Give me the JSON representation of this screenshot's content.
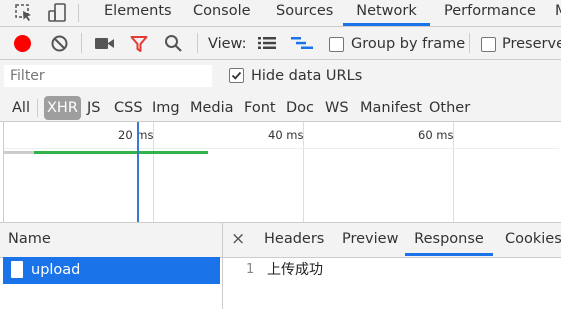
{
  "tabs": {
    "elements": "Elements",
    "console": "Console",
    "sources": "Sources",
    "network": "Network",
    "performance": "Performance",
    "memory_partial": "M"
  },
  "toolbar": {
    "view_label": "View:",
    "group_by_frame": "Group by frame",
    "preserve_log": "Preserve"
  },
  "filter": {
    "placeholder": "Filter",
    "hide_data_urls": "Hide data URLs"
  },
  "types": {
    "all": "All",
    "xhr": "XHR",
    "js": "JS",
    "css": "CSS",
    "img": "Img",
    "media": "Media",
    "font": "Font",
    "doc": "Doc",
    "ws": "WS",
    "manifest": "Manifest",
    "other": "Other"
  },
  "timeline": {
    "ticks": [
      "20 ms",
      "40 ms",
      "60 ms"
    ]
  },
  "requests": {
    "name_header": "Name",
    "rows": [
      {
        "name": "upload"
      }
    ]
  },
  "details": {
    "close": "×",
    "headers": "Headers",
    "preview": "Preview",
    "response": "Response",
    "cookies": "Cookies",
    "line_number": "1",
    "response_text": "上传成功"
  },
  "colors": {
    "accent": "#1a73e8",
    "record": "#ff0000",
    "filter_icon": "#e53935",
    "selected_row": "#1a73e8",
    "timing_green": "#33b249",
    "cursor_line": "#3a78d6"
  },
  "icons": {
    "inspect": "inspect-element-icon",
    "device": "device-toolbar-icon",
    "record": "record-icon",
    "clear": "clear-icon",
    "camera": "screenshot-capture-icon",
    "filter": "filter-icon",
    "search": "search-icon",
    "list_view": "large-rows-icon",
    "waterfall_view": "waterfall-overview-icon",
    "close": "close-icon",
    "file": "document-icon"
  }
}
